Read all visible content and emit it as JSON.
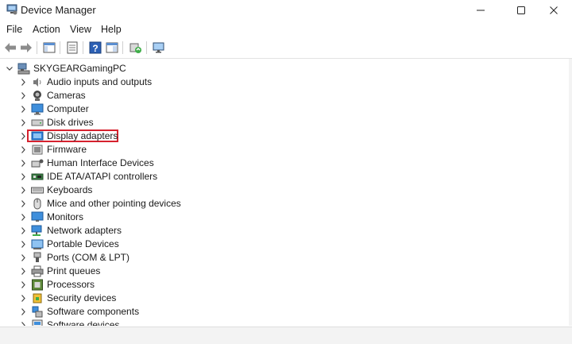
{
  "window": {
    "title": "Device Manager"
  },
  "menu": [
    "File",
    "Action",
    "View",
    "Help"
  ],
  "tree": {
    "root": "SKYGEARGamingPC",
    "categories": [
      {
        "label": "Audio inputs and outputs",
        "icon": "speaker-icon"
      },
      {
        "label": "Cameras",
        "icon": "camera-icon"
      },
      {
        "label": "Computer",
        "icon": "computer-icon"
      },
      {
        "label": "Disk drives",
        "icon": "disk-drive-icon"
      },
      {
        "label": "Display adapters",
        "icon": "display-adapter-icon",
        "highlighted": true
      },
      {
        "label": "Firmware",
        "icon": "firmware-icon"
      },
      {
        "label": "Human Interface Devices",
        "icon": "hid-icon"
      },
      {
        "label": "IDE ATA/ATAPI controllers",
        "icon": "ide-controller-icon"
      },
      {
        "label": "Keyboards",
        "icon": "keyboard-icon"
      },
      {
        "label": "Mice and other pointing devices",
        "icon": "mouse-icon"
      },
      {
        "label": "Monitors",
        "icon": "monitor-icon"
      },
      {
        "label": "Network adapters",
        "icon": "network-adapter-icon"
      },
      {
        "label": "Portable Devices",
        "icon": "portable-device-icon"
      },
      {
        "label": "Ports (COM & LPT)",
        "icon": "port-icon"
      },
      {
        "label": "Print queues",
        "icon": "printer-icon"
      },
      {
        "label": "Processors",
        "icon": "processor-icon"
      },
      {
        "label": "Security devices",
        "icon": "security-device-icon"
      },
      {
        "label": "Software components",
        "icon": "software-component-icon"
      },
      {
        "label": "Software devices",
        "icon": "software-device-icon"
      }
    ]
  },
  "colors": {
    "highlight_border": "#d6222f",
    "icon_blue": "#2f7ed8"
  }
}
